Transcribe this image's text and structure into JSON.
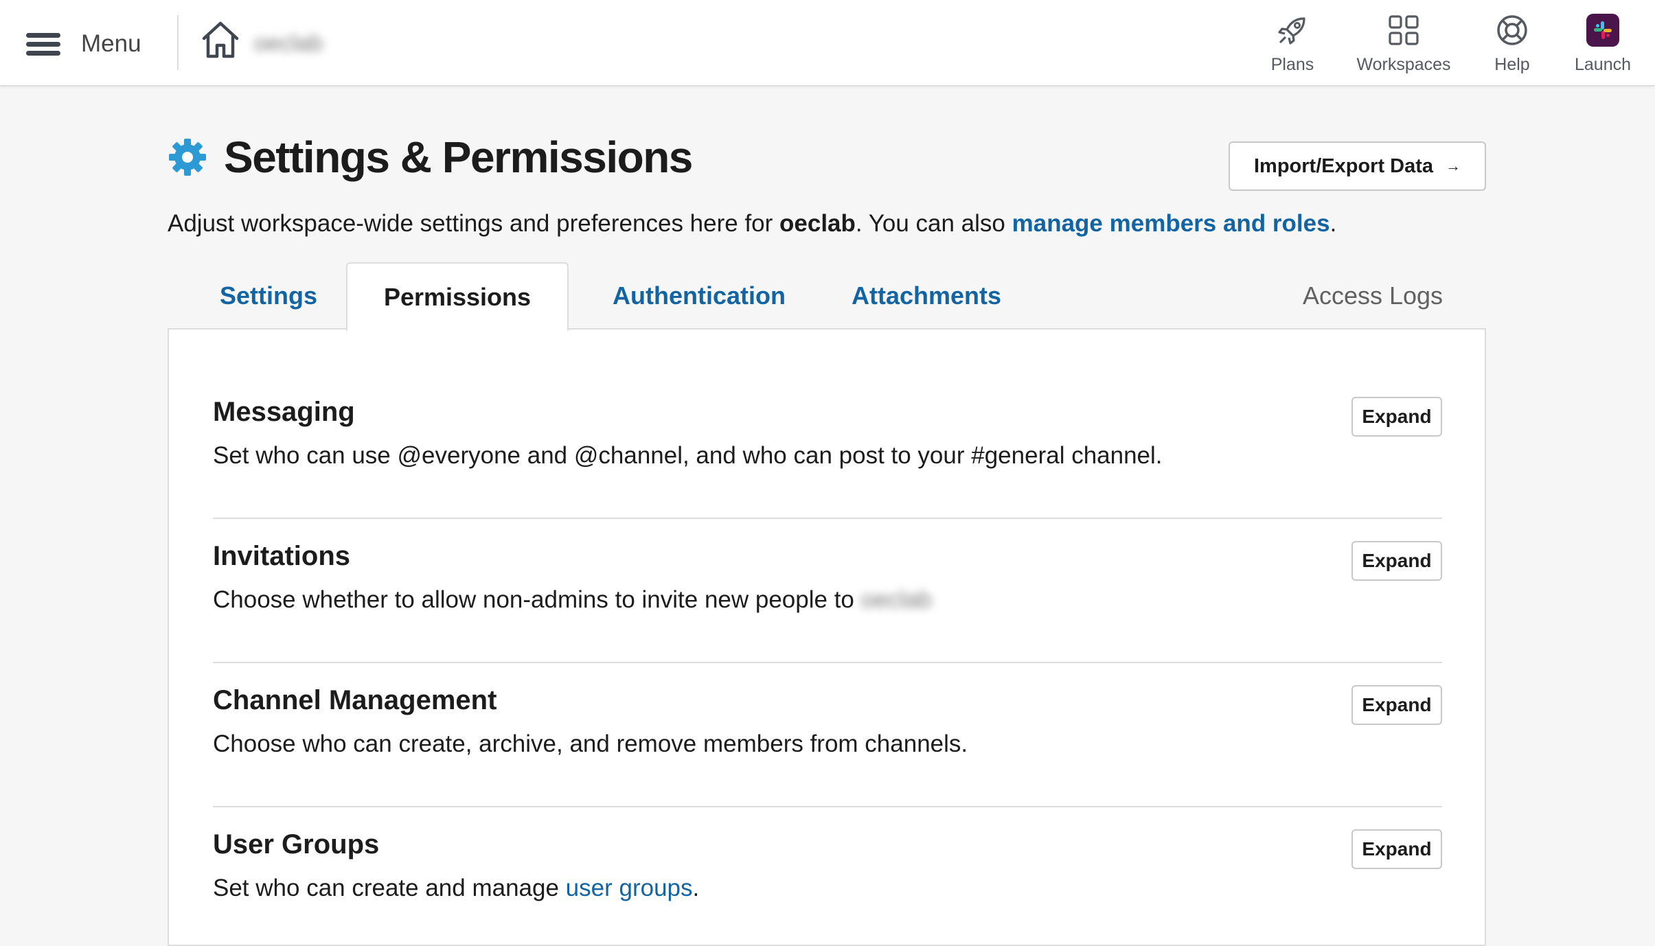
{
  "topbar": {
    "menu_label": "Menu",
    "workspace_name": "oeclab",
    "nav": [
      {
        "label": "Plans",
        "icon": "rocket-icon"
      },
      {
        "label": "Workspaces",
        "icon": "grid-icon"
      },
      {
        "label": "Help",
        "icon": "lifebuoy-icon"
      },
      {
        "label": "Launch",
        "icon": "slack-logo-icon"
      }
    ]
  },
  "header": {
    "title": "Settings & Permissions",
    "import_button": "Import/Export Data",
    "import_arrow": "→",
    "intro_prefix": "Adjust workspace-wide settings and preferences here for ",
    "intro_workspace": "oeclab",
    "intro_middle": ". You can also ",
    "intro_link": "manage members and roles",
    "intro_suffix": "."
  },
  "tabs": [
    {
      "label": "Settings",
      "active": false
    },
    {
      "label": "Permissions",
      "active": true
    },
    {
      "label": "Authentication",
      "active": false
    },
    {
      "label": "Attachments",
      "active": false
    },
    {
      "label": "Access Logs",
      "active": false
    }
  ],
  "sections": [
    {
      "title": "Messaging",
      "desc": "Set who can use @everyone and @channel, and who can post to your #general channel.",
      "button": "Expand"
    },
    {
      "title": "Invitations",
      "desc": "Choose whether to allow non-admins to invite new people to ",
      "desc_blurred": "oeclab",
      "button": "Expand"
    },
    {
      "title": "Channel Management",
      "desc": "Choose who can create, archive, and remove members from channels.",
      "button": "Expand"
    },
    {
      "title": "User Groups",
      "desc": "Set who can create and manage ",
      "desc_link": "user groups",
      "desc_suffix": ".",
      "button": "Expand"
    }
  ],
  "colors": {
    "link": "#1264a3",
    "gear": "#2d9ad6",
    "slack_tile": "#4a154b"
  }
}
